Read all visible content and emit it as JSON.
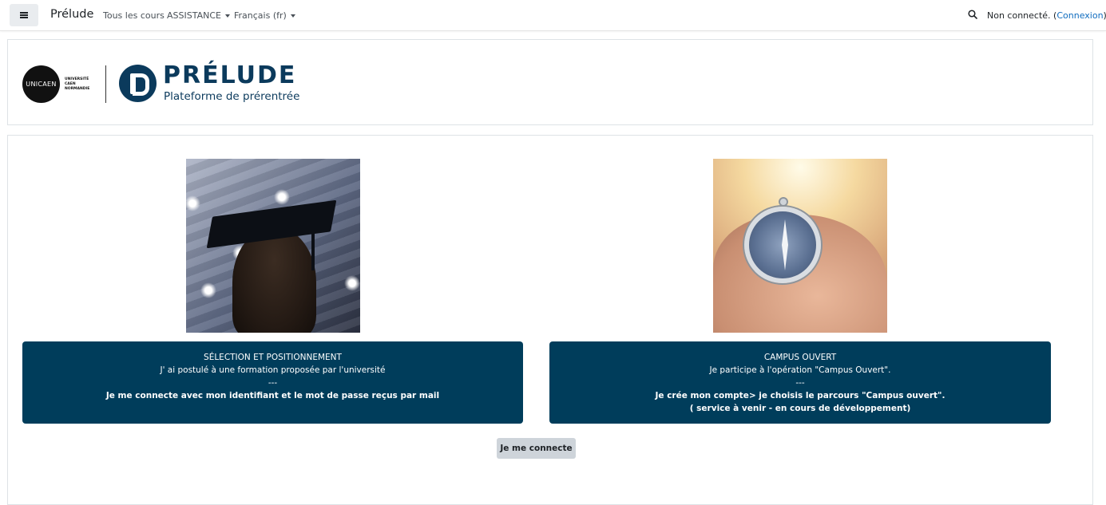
{
  "navbar": {
    "brand": "Prélude",
    "links": [
      {
        "label": "Tous les cours"
      },
      {
        "label": "ASSISTANCE"
      },
      {
        "label": "Français (fr)"
      }
    ],
    "login_text": "Non connecté. (",
    "login_link": "Connexion",
    "login_close": ")"
  },
  "header": {
    "unicaen_logo": "UNICAEN",
    "unicaen_line1": "UNIVERSITÉ",
    "unicaen_line2": "CAEN",
    "unicaen_line3": "NORMANDIE",
    "title": "PRÉLUDE",
    "subtitle": "Plateforme de prérentrée"
  },
  "panels": [
    {
      "title": "SÉLECTION ET POSITIONNEMENT",
      "line1": "J' ai postulé à une formation proposée par l'université",
      "separator": "---",
      "line2": "Je me connecte avec mon  identifiant et le mot de passe  reçus par mail"
    },
    {
      "title": "CAMPUS OUVERT",
      "line1": "Je participe à l'opération \"Campus Ouvert\".",
      "separator": "---",
      "line2": "Je crée mon compte> je choisis le parcours \"Campus ouvert\".",
      "line3": "( service à venir - en cours de développement)"
    }
  ],
  "connect_button": "Je me connecte",
  "icons": {
    "drawer": "hamburger-icon",
    "search": "search-icon"
  },
  "colors": {
    "panel_bg": "#003d5b",
    "brand_blue": "#0b3a5c",
    "link": "#0f6cbf"
  }
}
